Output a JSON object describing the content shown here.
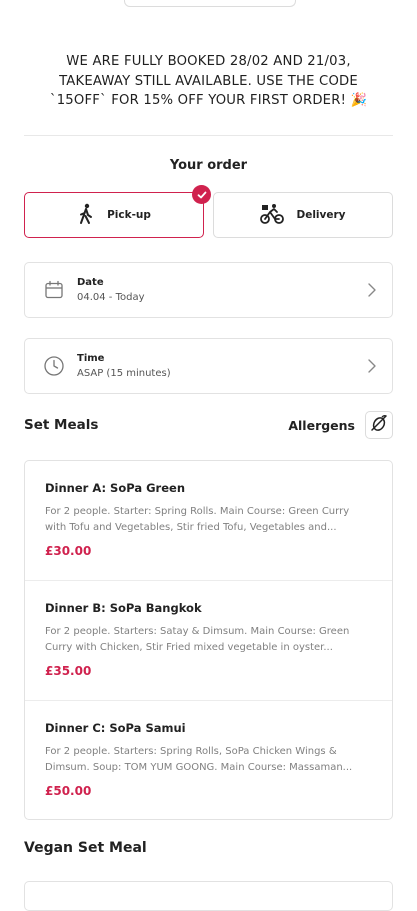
{
  "notice": {
    "lines": [
      "WE ARE FULLY BOOKED 28/02 AND 21/03,",
      "TAKEAWAY STILL AVAILABLE. USE THE CODE",
      "`15OFF` FOR 15% OFF YOUR FIRST ORDER! 🎉"
    ]
  },
  "order": {
    "title": "Your order",
    "pickup_label": "Pick-up",
    "delivery_label": "Delivery",
    "selected_mode": "Pick-up",
    "date_label": "Date",
    "date_value": "04.04 - Today",
    "time_label": "Time",
    "time_value": "ASAP (15 minutes)"
  },
  "menu": {
    "section_title": "Set Meals",
    "allergens_label": "Allergens",
    "meals": [
      {
        "name": "Dinner A: SoPa Green",
        "description": "For 2 people. Starter: Spring Rolls. Main Course: Green Curry with Tofu and Vegetables, Stir fried Tofu, Vegetables and...",
        "price": "£30.00"
      },
      {
        "name": "Dinner B: SoPa Bangkok",
        "description": "For 2 people. Starters: Satay & Dimsum. Main Course: Green Curry with Chicken, Stir Fried mixed vegetable in oyster...",
        "price": "£35.00"
      },
      {
        "name": "Dinner C: SoPa Samui",
        "description": "For 2 people. Starters: Spring Rolls, SoPa Chicken Wings & Dimsum. Soup: TOM YUM GOONG. Main Course: Massaman...",
        "price": "£50.00"
      }
    ],
    "next_section_title": "Vegan Set Meal"
  },
  "colors": {
    "accent": "#d0224e",
    "border": "#e2e2e2"
  },
  "icons": {
    "pickup": "walking-person-icon",
    "delivery": "bicycle-courier-icon",
    "date": "calendar-icon",
    "time": "clock-icon",
    "chevron": "chevron-right-icon",
    "allergens": "allergen-filter-icon",
    "selected": "check-icon"
  }
}
